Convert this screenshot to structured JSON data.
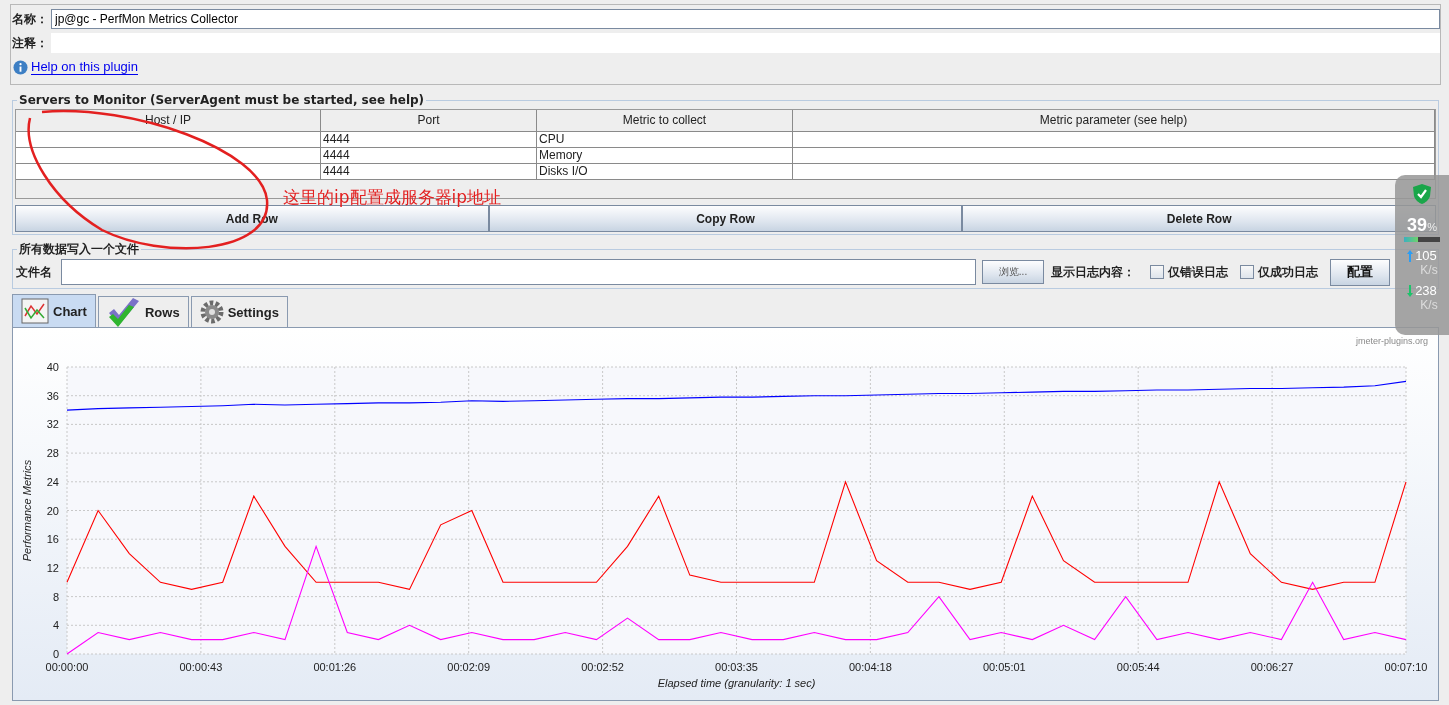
{
  "name_field": {
    "label": "名称：",
    "value": "jp@gc - PerfMon Metrics Collector"
  },
  "comment_field": {
    "label": "注释："
  },
  "help_link": "Help on this plugin",
  "servers": {
    "title": "Servers to Monitor (ServerAgent must be started, see help)",
    "columns": [
      "Host / IP",
      "Port",
      "Metric to collect",
      "Metric parameter (see help)"
    ],
    "rows": [
      {
        "port": "4444",
        "metric": "CPU"
      },
      {
        "port": "4444",
        "metric": "Memory"
      },
      {
        "port": "4444",
        "metric": "Disks I/O"
      }
    ],
    "buttons": [
      "Add Row",
      "Copy Row",
      "Delete Row"
    ]
  },
  "file_group": {
    "title": "所有数据写入一个文件",
    "file_label": "文件名",
    "browse": "浏览...",
    "log_label": "显示日志内容：",
    "checkboxes": [
      {
        "label": "仅错误日志",
        "checked": false
      },
      {
        "label": "仅成功日志",
        "checked": false
      }
    ],
    "config": "配置"
  },
  "tabs": [
    {
      "label": "Chart",
      "selected": true
    },
    {
      "label": "Rows",
      "selected": false
    },
    {
      "label": "Settings",
      "selected": false
    }
  ],
  "chart": {
    "watermark": "jmeter-plugins.org",
    "chart_data": {
      "type": "line",
      "grid": true,
      "xlabel": "Elapsed time (granularity: 1 sec)",
      "ylabel": "Performance Metrics",
      "x": [
        0,
        10,
        20,
        30,
        40,
        50,
        60,
        70,
        80,
        90,
        100,
        110,
        120,
        130,
        140,
        150,
        160,
        170,
        180,
        190,
        200,
        210,
        220,
        230,
        240,
        250,
        260,
        270,
        280,
        290,
        300,
        310,
        320,
        330,
        340,
        350,
        360,
        370,
        380,
        390,
        400,
        410,
        420,
        430
      ],
      "xlim": [
        0,
        430
      ],
      "ylim": [
        0,
        40
      ],
      "yticks": [
        0,
        4,
        8,
        12,
        16,
        20,
        24,
        28,
        32,
        36,
        40
      ],
      "xticks": [
        {
          "value": 0,
          "label": "00:00:00"
        },
        {
          "value": 43,
          "label": "00:00:43"
        },
        {
          "value": 86,
          "label": "00:01:26"
        },
        {
          "value": 129,
          "label": "00:02:09"
        },
        {
          "value": 172,
          "label": "00:02:52"
        },
        {
          "value": 215,
          "label": "00:03:35"
        },
        {
          "value": 258,
          "label": "00:04:18"
        },
        {
          "value": 301,
          "label": "00:05:01"
        },
        {
          "value": 344,
          "label": "00:05:44"
        },
        {
          "value": 387,
          "label": "00:06:27"
        },
        {
          "value": 430,
          "label": "00:07:10"
        }
      ],
      "series": [
        {
          "color": "#0000ff",
          "values": [
            34,
            34.2,
            34.3,
            34.4,
            34.5,
            34.6,
            34.8,
            34.7,
            34.8,
            34.9,
            35,
            35,
            35.1,
            35.3,
            35.2,
            35.3,
            35.4,
            35.5,
            35.6,
            35.6,
            35.7,
            35.8,
            35.8,
            35.9,
            36,
            36,
            36.1,
            36.2,
            36.3,
            36.3,
            36.4,
            36.5,
            36.6,
            36.6,
            36.7,
            36.8,
            36.8,
            36.9,
            37,
            37,
            37.1,
            37.2,
            37.4,
            38
          ]
        },
        {
          "color": "#ff0000",
          "values": [
            10,
            20,
            14,
            10,
            9,
            10,
            22,
            15,
            10,
            10,
            10,
            9,
            18,
            20,
            10,
            10,
            10,
            10,
            15,
            22,
            11,
            10,
            10,
            10,
            10,
            24,
            13,
            10,
            10,
            9,
            10,
            22,
            13,
            10,
            10,
            10,
            10,
            24,
            14,
            10,
            9,
            10,
            10,
            24
          ]
        },
        {
          "color": "#ff00ff",
          "values": [
            0,
            3,
            2,
            3,
            2,
            2,
            3,
            2,
            15,
            3,
            2,
            4,
            2,
            3,
            2,
            2,
            3,
            2,
            5,
            2,
            2,
            3,
            2,
            2,
            3,
            2,
            2,
            3,
            8,
            2,
            3,
            2,
            4,
            2,
            8,
            2,
            3,
            2,
            3,
            2,
            10,
            2,
            3,
            2
          ]
        }
      ]
    }
  },
  "annotation": {
    "text": "这里的ip配置成服务器ip地址"
  },
  "monitor": {
    "percent": "39",
    "unit": "%",
    "level": 0.39,
    "up": "105",
    "up_unit": "K/s",
    "down": "238",
    "down_unit": "K/s"
  }
}
